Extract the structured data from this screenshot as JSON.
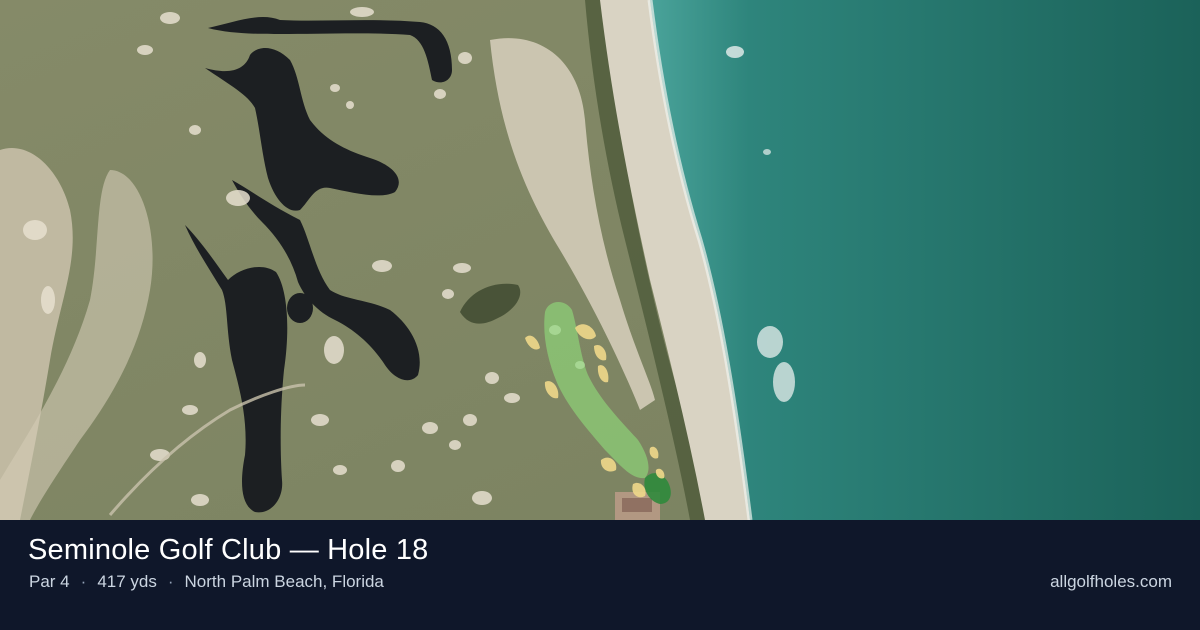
{
  "hole": {
    "title": "Seminole Golf Club — Hole 18",
    "par": "Par 4",
    "yardage": "417 yds",
    "location": "North Palm Beach, Florida"
  },
  "meta_separator": "·",
  "site": "allgolfholes.com",
  "colors": {
    "ocean_deep": "#1f6d64",
    "ocean_shallow": "#3f9a92",
    "beach": "#d9d3c3",
    "turf": "#7f8766",
    "water_hazard": "#1c1f22",
    "bunker": "#e6dfcf",
    "fairway_overlay": "#8fd97a",
    "green_overlay": "#2f8a3c",
    "bunker_overlay": "#f0d98a",
    "info_bar": "#0f172a"
  }
}
